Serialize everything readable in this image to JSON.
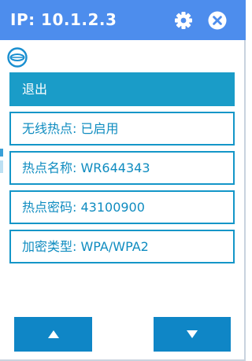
{
  "window": {
    "title": "IP: 10.1.2.3",
    "buttons": {
      "settings_icon": "gear-icon",
      "close_icon": "close-icon"
    }
  },
  "app": {
    "logo_icon": "app-logo-icon"
  },
  "menu": {
    "items": [
      {
        "label": "退出",
        "active": true
      },
      {
        "label": "无线热点: 已启用",
        "active": false
      },
      {
        "label": "热点名称: WR644343",
        "active": false
      },
      {
        "label": "热点密码: 43100900",
        "active": false
      },
      {
        "label": "加密类型: WPA/WPA2",
        "active": false
      }
    ]
  },
  "navigation": {
    "up_icon": "arrow-up-icon",
    "down_icon": "arrow-down-icon"
  },
  "colors": {
    "titlebar": "#4d8ded",
    "accent": "#1a9cc8",
    "nav_button": "#0f86c6",
    "item_text": "#0f8cc0",
    "item_border": "#1496c8"
  }
}
